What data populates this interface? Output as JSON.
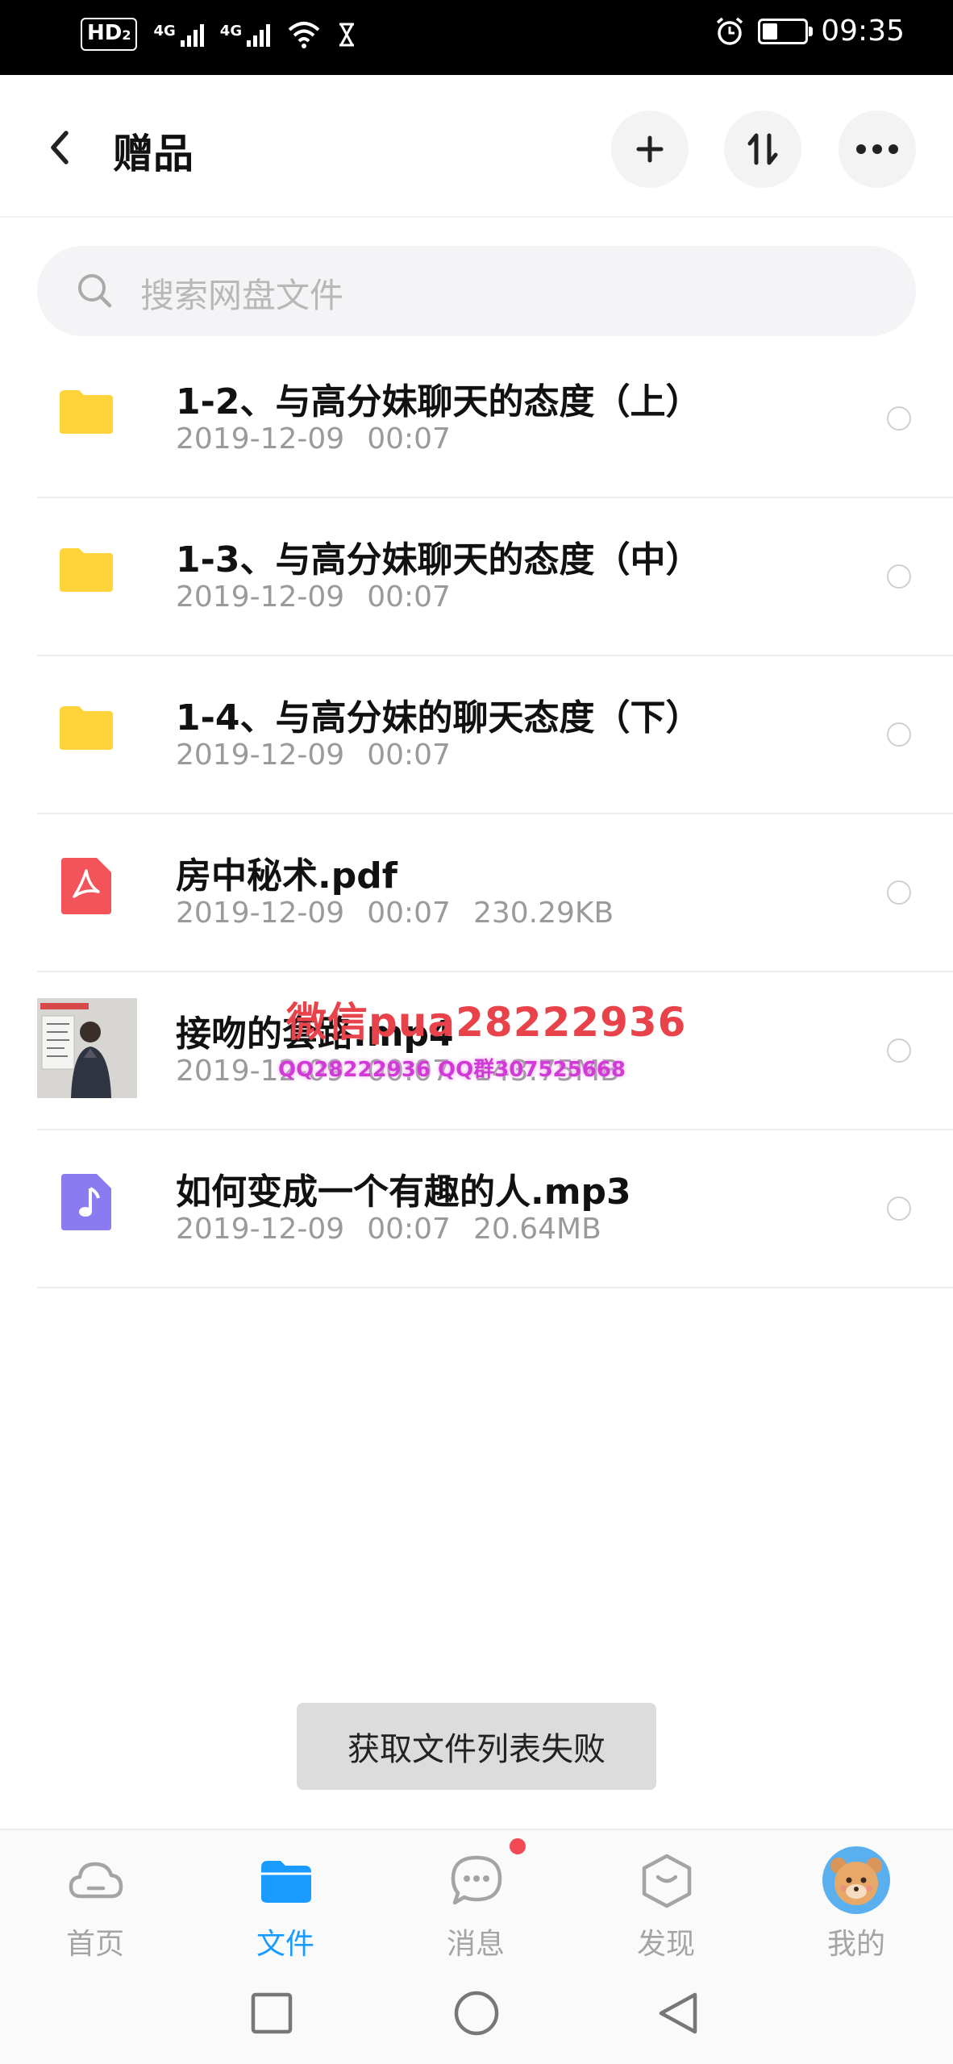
{
  "status_bar": {
    "hd_label": "HD",
    "hd_sub": "2",
    "signal_1": "4G",
    "signal_2": "4G",
    "time": "09:35",
    "battery_level": 0.35
  },
  "header": {
    "title": "赠品",
    "add_icon": "plus-icon",
    "sort_icon": "sort-icon",
    "more_icon": "more-icon"
  },
  "search": {
    "placeholder": "搜索网盘文件"
  },
  "files": [
    {
      "type": "folder",
      "icon": "folder-icon",
      "name": "1-2、与高分妹聊天的态度（上）",
      "date": "2019-12-09",
      "time": "00:07",
      "size": ""
    },
    {
      "type": "folder",
      "icon": "folder-icon",
      "name": "1-3、与高分妹聊天的态度（中）",
      "date": "2019-12-09",
      "time": "00:07",
      "size": ""
    },
    {
      "type": "folder",
      "icon": "folder-icon",
      "name": "1-4、与高分妹的聊天态度（下）",
      "date": "2019-12-09",
      "time": "00:07",
      "size": ""
    },
    {
      "type": "pdf",
      "icon": "pdf-icon",
      "name": "房中秘术.pdf",
      "date": "2019-12-09",
      "time": "00:07",
      "size": "230.29KB"
    },
    {
      "type": "video",
      "icon": "video-thumbnail",
      "name": "接吻的套路.mp4",
      "date": "2019-12-09",
      "time": "00:07",
      "size": "143.75MB"
    },
    {
      "type": "audio",
      "icon": "music-icon",
      "name": "如何变成一个有趣的人.mp3",
      "date": "2019-12-09",
      "time": "00:07",
      "size": "20.64MB"
    }
  ],
  "watermark": {
    "line1": "微信pua28222936",
    "line2": "QQ28222936 QQ群307525668"
  },
  "toast": "获取文件列表失败",
  "tabs": [
    {
      "label": "首页",
      "icon": "cloud-icon",
      "active": false
    },
    {
      "label": "文件",
      "icon": "folder-icon",
      "active": true
    },
    {
      "label": "消息",
      "icon": "chat-icon",
      "active": false,
      "badge": true
    },
    {
      "label": "发现",
      "icon": "discover-icon",
      "active": false
    },
    {
      "label": "我的",
      "icon": "avatar",
      "active": false
    }
  ],
  "colors": {
    "accent": "#1a9bff",
    "folder": "#ffd43b",
    "pdf": "#f25459",
    "audio": "#8a7cf0",
    "badge": "#f24a55"
  }
}
